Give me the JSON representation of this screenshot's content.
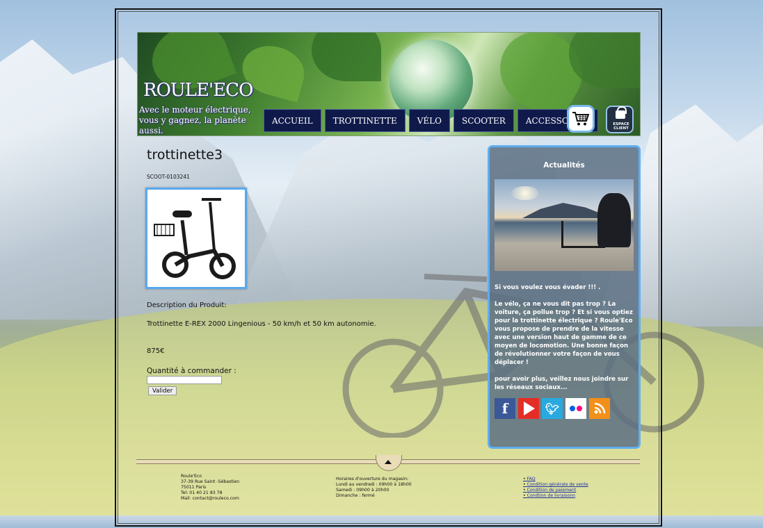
{
  "header": {
    "site_title": "ROULE'ECO",
    "tagline": "Avec le moteur électrique, vous y gagnez, la planète aussi.",
    "nav": [
      "ACCUEIL",
      "TROTTINETTE",
      "VÉLO",
      "SCOOTER",
      "ACCESSOIRES"
    ],
    "cart_icon": "shopping-cart-icon",
    "client_label": "ESPACE CLIENT"
  },
  "product": {
    "title": "trottinette3",
    "sku": "SCOOT-0103241",
    "description_heading": "Description du Produit:",
    "description": "Trottinette E-REX 2000 Lingenious - 50 km/h et 50 km autonomie.",
    "price": "875€",
    "quantity_label": "Quantité à commander :",
    "quantity_value": "",
    "submit_label": "Valider"
  },
  "sidebar": {
    "title": "Actualités",
    "p1": "Si vous voulez vous évader !!! .",
    "p2": "Le vélo, ça ne vous dit pas trop  ? La voiture, ça pollue trop  ? Et si vous optiez pour la trottinette électrique  ? Roule'Eco vous propose de prendre de la vitesse avec une version haut de gamme de ce moyen de locomotion. Une bonne façon de révolutionner votre façon de vous déplacer  !",
    "p3": "pour avoir plus, veillez nous joindre sur les réseaux sociaux...",
    "social": [
      "facebook-icon",
      "youtube-icon",
      "twitter-icon",
      "flickr-icon",
      "rss-icon"
    ],
    "colors": {
      "facebook": "#3b5998",
      "youtube": "#e52d27",
      "twitter": "#2aa9e0",
      "flickr": "#ffffff",
      "rss": "#f39019"
    }
  },
  "footer": {
    "address": [
      "Roule'Eco",
      "37-39 Rue Saint -Sébastien",
      "75011 Paris",
      "Tel: 01 40 21 83 78",
      "Mail: contact@rouleco.com"
    ],
    "hours": [
      "Horaires d'ouverture du magasin:",
      "Lundi au vendredi : 09h00 à 18h00",
      "Samedi : 09h00 à 20h00",
      "Dimanche : fermé"
    ],
    "links": [
      "FAQ",
      "Condition générale de vente",
      "Condition de paiement",
      "Condtion de livraisonn"
    ]
  }
}
